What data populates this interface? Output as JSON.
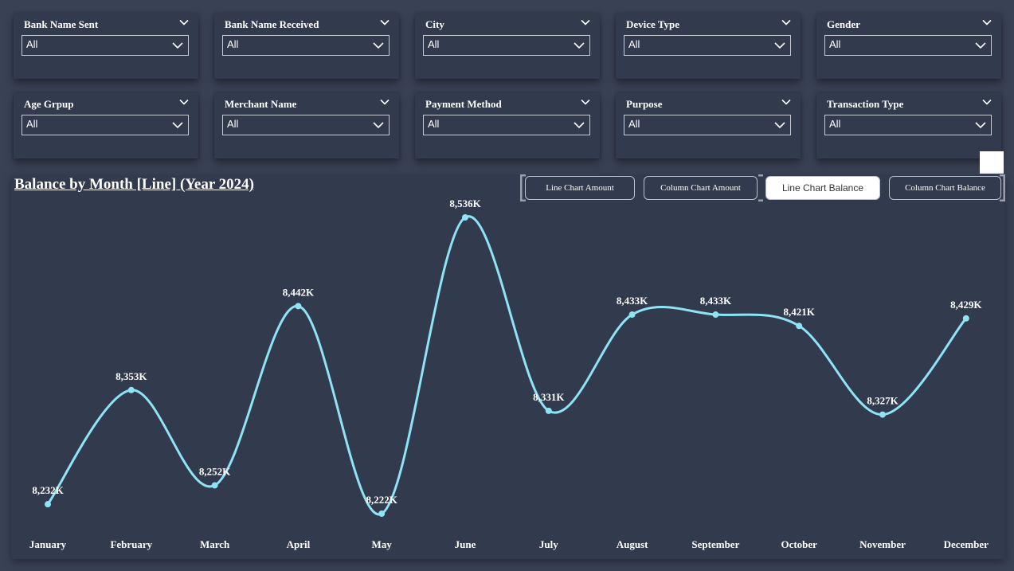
{
  "filters": [
    {
      "title": "Bank Name Sent",
      "value": "All"
    },
    {
      "title": "Bank Name Received",
      "value": "All"
    },
    {
      "title": "City",
      "value": "All"
    },
    {
      "title": "Device Type",
      "value": "All"
    },
    {
      "title": "Gender",
      "value": "All"
    },
    {
      "title": "Age Grpup",
      "value": "All"
    },
    {
      "title": "Merchant Name",
      "value": "All"
    },
    {
      "title": "Payment Method",
      "value": "All"
    },
    {
      "title": "Purpose",
      "value": "All"
    },
    {
      "title": "Transaction Type",
      "value": "All"
    }
  ],
  "buttons": [
    {
      "label": "Line Chart Amount",
      "active": false
    },
    {
      "label": "Column Chart Amount",
      "active": false
    },
    {
      "label": "Line Chart Balance",
      "active": true
    },
    {
      "label": "Column Chart Balance",
      "active": false
    }
  ],
  "colors": {
    "background": "#394155",
    "panel": "#323a4e",
    "line": "#8ee3f5",
    "text": "#ffffff"
  },
  "chart_data": {
    "type": "line",
    "title": "Balance by Month [Line] (Year 2024)",
    "categories": [
      "January",
      "February",
      "March",
      "April",
      "May",
      "June",
      "July",
      "August",
      "September",
      "October",
      "November",
      "December"
    ],
    "values": [
      8232,
      8353,
      8252,
      8442,
      8222,
      8536,
      8331,
      8433,
      8433,
      8421,
      8327,
      8429
    ],
    "labels": [
      "8,232K",
      "8,353K",
      "8,252K",
      "8,442K",
      "8,222K",
      "8,536K",
      "8,331K",
      "8,433K",
      "8,433K",
      "8,421K",
      "8,327K",
      "8,429K"
    ],
    "ylim": [
      8222,
      8536
    ],
    "grid": false,
    "smooth": true
  }
}
